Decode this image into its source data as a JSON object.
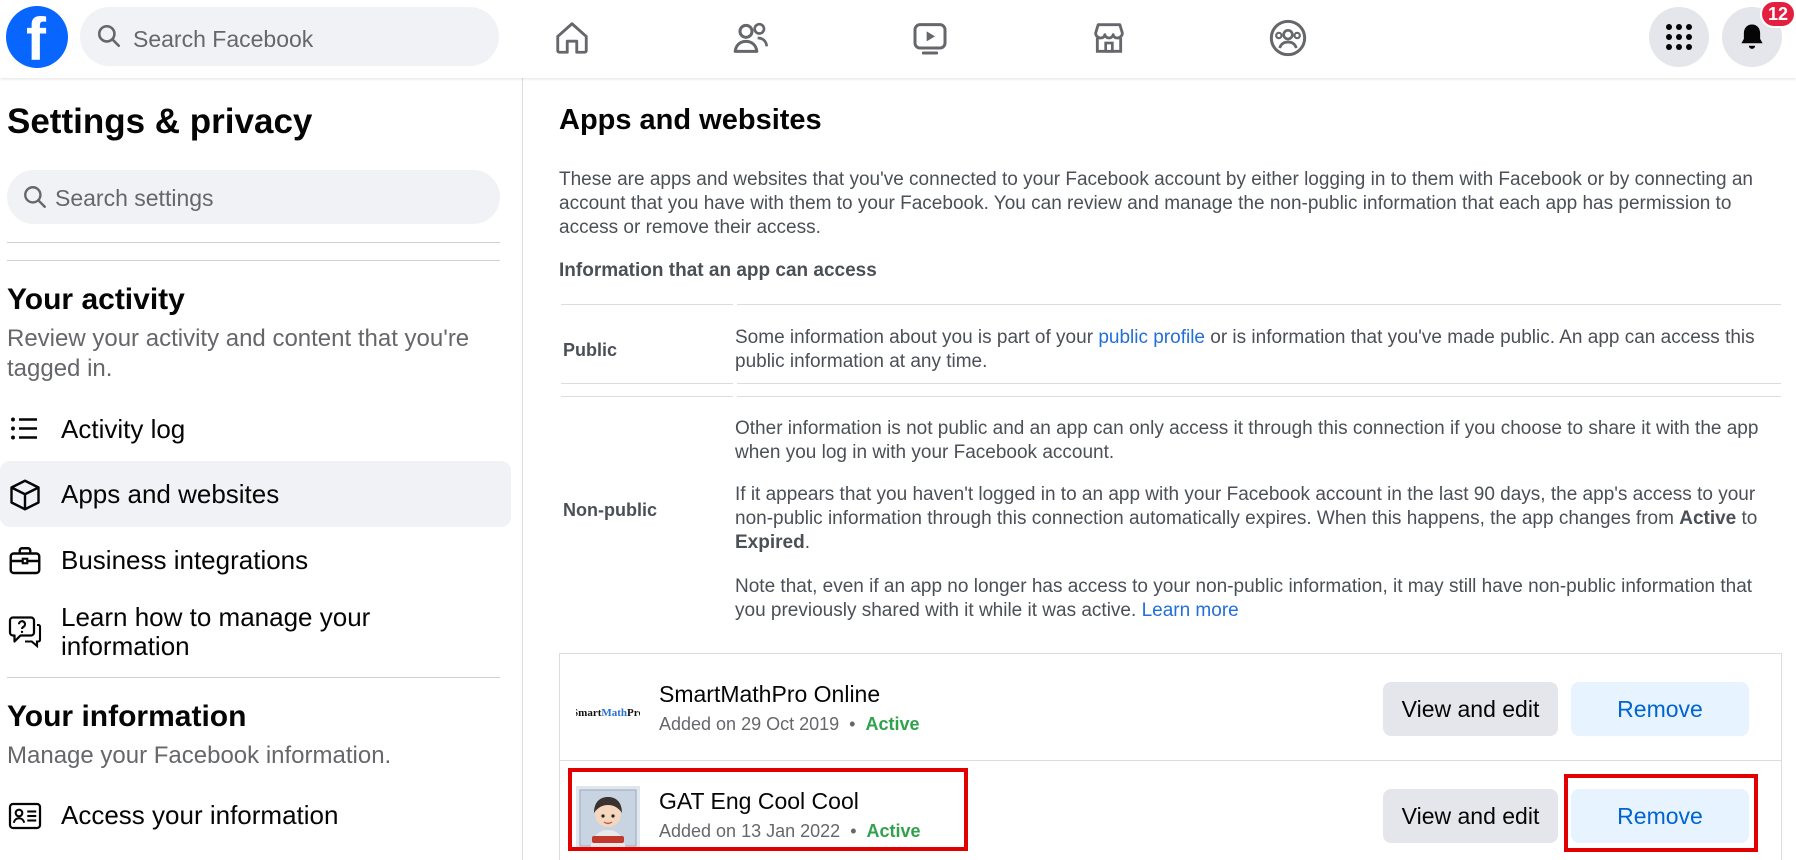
{
  "topbar": {
    "search_placeholder": "Search Facebook",
    "notification_count": "12"
  },
  "sidebar": {
    "title": "Settings & privacy",
    "search_placeholder": "Search settings",
    "activity": {
      "heading": "Your activity",
      "description": "Review your activity and content that you're tagged in.",
      "items": [
        {
          "label": "Activity log",
          "icon": "list-icon"
        },
        {
          "label": "Apps and websites",
          "icon": "cube-icon"
        },
        {
          "label": "Business integrations",
          "icon": "briefcase-icon"
        },
        {
          "label": "Learn how to manage your information",
          "icon": "question-bubble-icon"
        }
      ]
    },
    "information": {
      "heading": "Your information",
      "description": "Manage your Facebook information.",
      "items": [
        {
          "label": "Access your information",
          "icon": "id-card-icon"
        }
      ]
    }
  },
  "main": {
    "title": "Apps and websites",
    "intro": "These are apps and websites that you've connected to your Facebook account by either logging in to them with Facebook or by connecting an account that you have with them to your Facebook. You can review and manage the non-public information that each app has permission to access or remove their access.",
    "subheading": "Information that an app can access",
    "public": {
      "label": "Public",
      "text_before": "Some information about you is part of your ",
      "link": "public profile",
      "text_after": " or is information that you've made public. An app can access this public information at any time."
    },
    "non_public": {
      "label": "Non-public",
      "para1": "Other information is not public and an app can only access it through this connection if you choose to share it with the app when you log in with your Facebook account.",
      "para2_before": "If it appears that you haven't logged in to an app with your Facebook account in the last 90 days, the app's access to your non-public information through this connection automatically expires. When this happens, the app changes from ",
      "para2_active": "Active",
      "para2_mid": " to ",
      "para2_expired": "Expired",
      "para2_end": ".",
      "para3": "Note that, even if an app no longer has access to your non-public information, it may still have non-public information that you previously shared with it while it was active. ",
      "para3_link": "Learn more"
    },
    "apps": [
      {
        "name": "SmartMathPro Online",
        "added": "Added on 29 Oct 2019",
        "status": "Active",
        "logo_text": "SmartMathPro",
        "edit_label": "View and edit",
        "remove_label": "Remove"
      },
      {
        "name": "GAT Eng Cool Cool",
        "added": "Added on 13 Jan 2022",
        "status": "Active",
        "edit_label": "View and edit",
        "remove_label": "Remove"
      }
    ],
    "dot": "•"
  },
  "colors": {
    "brand": "#0866ff",
    "link": "#216fdb",
    "active_status": "#31a24c",
    "highlight": "#e00000"
  }
}
